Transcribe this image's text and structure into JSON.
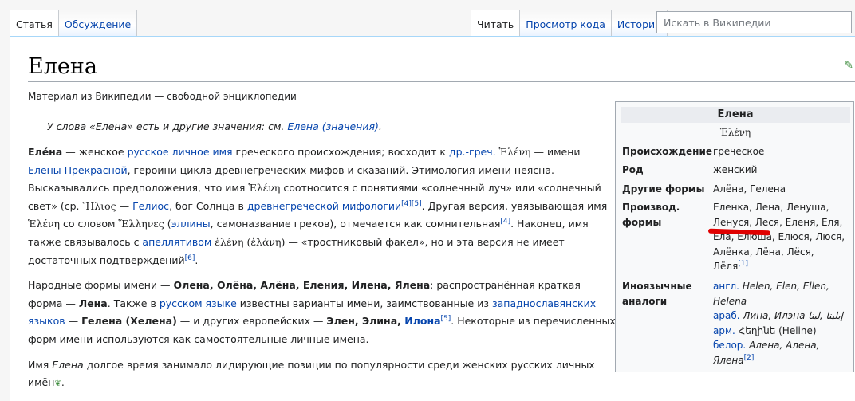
{
  "tabs": {
    "left": [
      "Статья",
      "Обсуждение"
    ],
    "right": [
      "Читать",
      "Просмотр кода",
      "История"
    ]
  },
  "search": {
    "placeholder": "Искать в Википедии"
  },
  "page": {
    "title": "Елена",
    "subtitle": "Материал из Википедии — свободной энциклопедии"
  },
  "hatnote": {
    "text": "У слова «Елена» есть и другие значения: см.",
    "link": "Елена (значения)",
    "end": "."
  },
  "paragraph1": {
    "name_bold": "Еле́на",
    "t1": " — женское ",
    "link1": "русское личное имя",
    "t2": " греческого происхождения; восходит к ",
    "link2": "др.-греч.",
    "greek1": " Ἑλένη",
    "t3": " — имени ",
    "link3": "Елены Прекрасной",
    "t4": ", героини цикла древнегреческих мифов и сказаний. Этимология имени неясна. Высказывались предположения, что имя ",
    "greek2": "Ἑλένη",
    "t5": " соотносится с понятиями «солнечный луч» или «солнечный свет» (ср. ",
    "greek3": "Ἥλιος",
    "t6": " — ",
    "link4": "Гелиос",
    "t7": ", бог Солнца в ",
    "link5": "древнегреческой мифологии",
    "ref1": "[4][5]",
    "t8": ". Другая версия, увязывающая имя ",
    "greek4": "Ἑλένη",
    "t9": " со словом ",
    "greek5": "Ἕλληνες",
    "t10": " (",
    "link6": "эллины",
    "t11": ", самоназвание греков), отмечается как сомнительная",
    "ref2": "[4]",
    "t12": ". Наконец, имя также связывалось с ",
    "link7": "апеллятивом",
    "greek6": " ἑλένη (ἑλάνη)",
    "t13": " — «тростниковый факел», но и эта версия не имеет достаточных подтверждений",
    "ref3": "[6]",
    "t14": "."
  },
  "paragraph2": {
    "t1": "Народные формы имени — ",
    "b1": "Олена, Олёна, Алёна, Еления, Илена, Ялена",
    "t2": "; распространённая краткая форма — ",
    "b2": "Лена",
    "t3": ". Также в ",
    "link1": "русском языке",
    "t4": " известны варианты имени, заимствованные из ",
    "link2": "западнославянских языков",
    "t5": " — ",
    "b3": "Гелена (Хелена)",
    "t6": " — и других европейских — ",
    "b4": "Элен, Элина, ",
    "link3": "Илона",
    "ref1": "[5]",
    "t7": ". Некоторые из перечисленных форм имени используются как самостоятельные личные имена."
  },
  "paragraph3": {
    "t1": "Имя ",
    "i1": "Елена",
    "t2": " долгое время занимало лидирующие позиции по популярности среди женских русских личных имён",
    "icon": "featured-leaf-icon"
  },
  "infobox": {
    "title": "Елена",
    "original": "Ἑλένη",
    "rows": [
      {
        "label": "Происхождение",
        "value": "греческое"
      },
      {
        "label": "Род",
        "value": "женский"
      },
      {
        "label": "Другие формы",
        "value": "Алёна, Гелена"
      },
      {
        "label": "Производ. формы",
        "value": "Еленка, Лена, Ленуша, Ленуся, Леся, Еленя, Еля, Ела, Елюша, Елюся, Люся, Алёнка, Лёна, Лёся, Лёля",
        "ref": "[1]"
      }
    ],
    "analogs": {
      "label": "Иноязычные аналоги",
      "items": [
        {
          "lang": "англ.",
          "value": "Helen, Elen, Ellen, Helena"
        },
        {
          "lang": "араб.",
          "value": "Лина, Илэна إيلينا ,لينا"
        },
        {
          "lang": "арм.",
          "value": "Հեղինե (Heline)"
        },
        {
          "lang": "белор.",
          "value": "Алена, Алена, Ялена",
          "ref": "[2]"
        }
      ]
    }
  },
  "colors": {
    "link": "#0645ad",
    "annotation": "#e00000",
    "border": "#a2a9b1"
  }
}
